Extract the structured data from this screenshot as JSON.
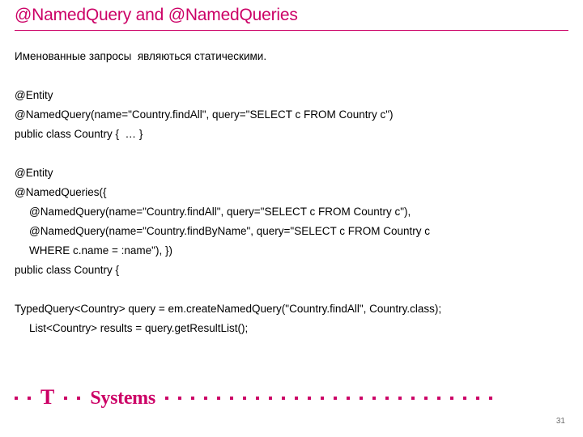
{
  "slide": {
    "title": "@NamedQuery and @NamedQueries",
    "accent_color": "#CC0066",
    "page_number": "31",
    "body_lines": [
      "Именованные запросы  являються статическими.",
      "",
      "@Entity",
      "@NamedQuery(name=\"Country.findAll\", query=\"SELECT c FROM Country c\")",
      "public class Country {  … }",
      "",
      "@Entity",
      "@NamedQueries({",
      "@NamedQuery(name=\"Country.findAll\", query=\"SELECT c FROM Country c\"),",
      "@NamedQuery(name=\"Country.findByName\", query=\"SELECT c FROM Country c",
      "WHERE c.name = :name\"), })",
      "public class Country {",
      "",
      "TypedQuery<Country> query = em.createNamedQuery(\"Country.findAll\", Country.class);",
      "List<Country> results = query.getResultList();"
    ]
  },
  "footer": {
    "logo_t": "T",
    "logo_word": "Systems",
    "leading_dot_count": 2,
    "mid_dot_count": 2,
    "trailing_dot_count": 26
  }
}
